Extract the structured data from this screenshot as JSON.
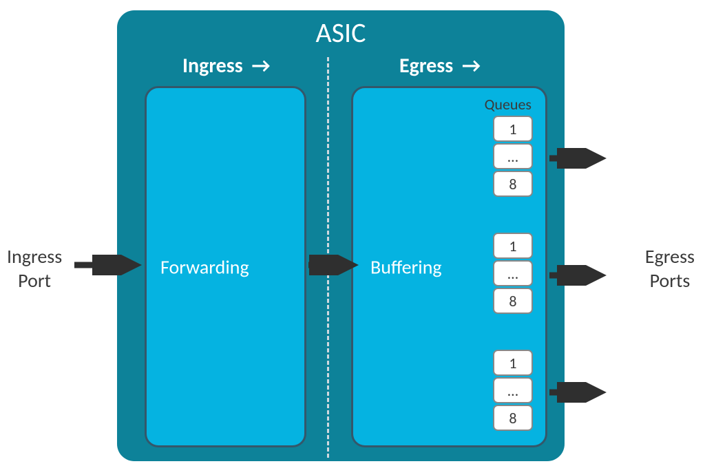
{
  "asic": {
    "title": "ASIC",
    "stages": {
      "ingress": "Ingress",
      "egress": "Egress"
    },
    "forwarding_label": "Forwarding",
    "buffering_label": "Buffering",
    "queues_label": "Queues",
    "queue_groups": [
      {
        "items": [
          "1",
          "…",
          "8"
        ]
      },
      {
        "items": [
          "1",
          "…",
          "8"
        ]
      },
      {
        "items": [
          "1",
          "…",
          "8"
        ]
      }
    ]
  },
  "labels": {
    "ingress_port": "Ingress\nPort",
    "egress_ports": "Egress\nPorts"
  },
  "colors": {
    "asic_bg": "#0d8299",
    "inner_bg": "#05b3e1",
    "border": "#34576a",
    "arrow": "#2f2f2f"
  }
}
